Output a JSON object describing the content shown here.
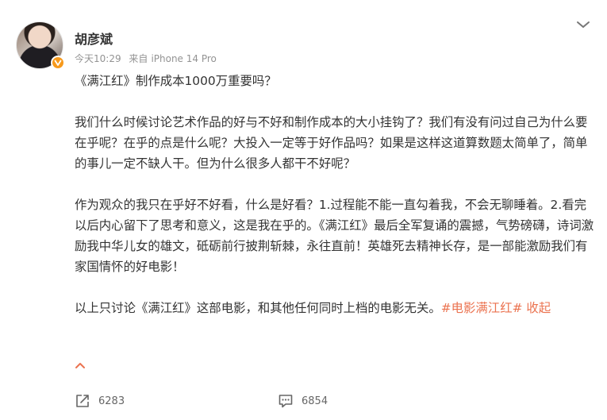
{
  "post": {
    "author": "胡彦斌",
    "time": "今天10:29",
    "source_label": "来自",
    "source": "iPhone 14 Pro",
    "paragraphs": [
      "《满江红》制作成本1000万重要吗？",
      "我们什么时候讨论艺术作品的好与不好和制作成本的大小挂钩了？我们有没有问过自己为什么要在乎呢？在乎的点是什么呢？大投入一定等于好作品吗？如果是这样这道算数题太简单了，简单的事儿一定不缺人干。但为什么很多人都干不好呢？",
      "作为观众的我只在乎好不好看，什么是好看？1.过程能不能一直勾着我，不会无聊睡着。2.看完以后内心留下了思考和意义，这是我在乎的。《满江红》最后全军复诵的震撼，气势磅礴，诗词激励我中华儿女的雄文，砥砺前行披荆斩棘，永往直前！英雄死去精神长存，是一部能激励我们有家国情怀的好电影！"
    ],
    "last_paragraph": "以上只讨论《满江红》这部电影，和其他任何同时上档的电影无关。",
    "hashtag": "#电影满江红#",
    "collapse_label": "收起"
  },
  "actions": {
    "repost_count": "6283",
    "comment_count": "6854"
  },
  "icons": {
    "verified": "verified-badge-icon",
    "menu": "chevron-down-icon",
    "collapse": "chevron-up-icon",
    "repost": "repost-icon",
    "comment": "comment-icon"
  },
  "colors": {
    "accent": "#eb7350",
    "verified": "#f79a1c",
    "meta": "#939393",
    "text": "#333333"
  }
}
